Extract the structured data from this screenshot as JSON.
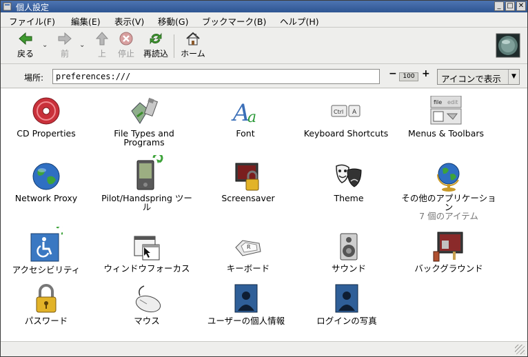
{
  "window": {
    "title": "個人設定"
  },
  "menubar": [
    {
      "label": "ファイル(F)"
    },
    {
      "label": "編集(E)"
    },
    {
      "label": "表示(V)"
    },
    {
      "label": "移動(G)"
    },
    {
      "label": "ブックマーク(B)"
    },
    {
      "label": "ヘルプ(H)"
    }
  ],
  "toolbar": {
    "back": "戻る",
    "forward": "前",
    "up": "上",
    "stop": "停止",
    "reload": "再読込",
    "home": "ホーム"
  },
  "location": {
    "label": "場所:",
    "value": "preferences:///",
    "zoom_minus": "−",
    "zoom_value": "100",
    "zoom_plus": "+",
    "view_mode": "アイコンで表示"
  },
  "items": [
    {
      "label": "CD Properties",
      "icon": "cd-icon"
    },
    {
      "label": "File Types and Programs",
      "icon": "file-types-icon"
    },
    {
      "label": "Font",
      "icon": "font-icon"
    },
    {
      "label": "Keyboard Shortcuts",
      "icon": "keyboard-shortcuts-icon"
    },
    {
      "label": "Menus & Toolbars",
      "icon": "menus-toolbars-icon"
    },
    {
      "label": "Network Proxy",
      "icon": "globe-icon"
    },
    {
      "label": "Pilot/Handspring ツール",
      "icon": "pda-icon"
    },
    {
      "label": "Screensaver",
      "icon": "screensaver-lock-icon"
    },
    {
      "label": "Theme",
      "icon": "theme-masks-icon"
    },
    {
      "label": "その他のアプリケーション",
      "sublabel": "7 個のアイテム",
      "icon": "globe-stand-icon"
    },
    {
      "label": "アクセシビリティ",
      "icon": "accessibility-icon"
    },
    {
      "label": "ウィンドウフォーカス",
      "icon": "window-focus-icon"
    },
    {
      "label": "キーボード",
      "icon": "keyboard-key-icon"
    },
    {
      "label": "サウンド",
      "icon": "speaker-icon"
    },
    {
      "label": "バックグラウンド",
      "icon": "background-paint-icon"
    },
    {
      "label": "パスワード",
      "icon": "padlock-icon"
    },
    {
      "label": "マウス",
      "icon": "mouse-icon"
    },
    {
      "label": "ユーザーの個人情報",
      "icon": "user-photo-icon"
    },
    {
      "label": "ログインの写真",
      "icon": "login-photo-icon"
    }
  ],
  "colors": {
    "titlebar": "#3a62a3",
    "window_bg": "#eeeeec",
    "content_bg": "#ffffff"
  }
}
